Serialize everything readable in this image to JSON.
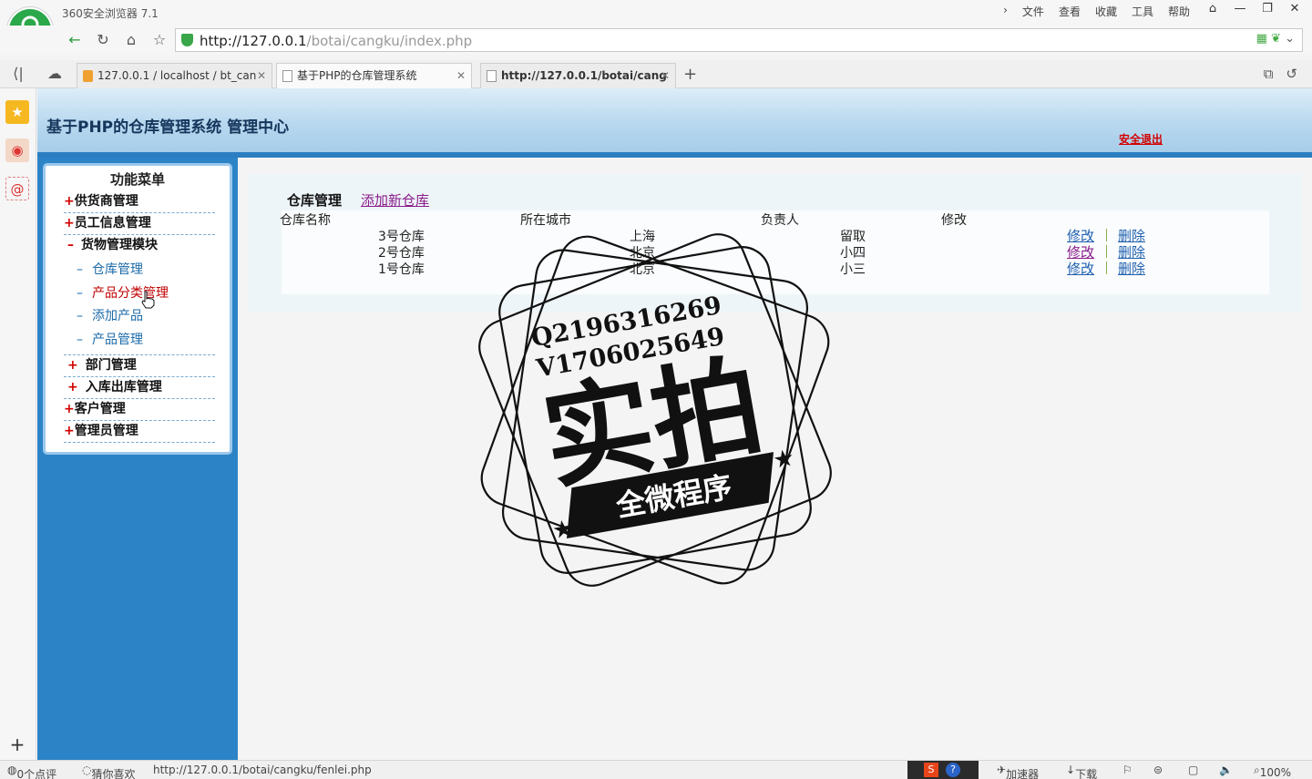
{
  "browser": {
    "name": "360安全浏览器 7.1",
    "menu": [
      "文件",
      "查看",
      "收藏",
      "工具",
      "帮助"
    ],
    "url_host": "http://127.0.0.1",
    "url_path": "/botai/cangku/index.php",
    "tabs": [
      {
        "label": "127.0.0.1 / localhost / bt_can"
      },
      {
        "label": "基于PHP的仓库管理系统"
      },
      {
        "label": "http://127.0.0.1/botai/cang"
      }
    ]
  },
  "header": {
    "title": "基于PHP的仓库管理系统 管理中心",
    "logout": "安全退出"
  },
  "sidebar": {
    "title": "功能菜单",
    "items": [
      {
        "mark": "+",
        "label": "供货商管理"
      },
      {
        "mark": "+",
        "label": "员工信息管理"
      },
      {
        "mark": "–",
        "label": "货物管理模块"
      },
      {
        "mark": "+",
        "label": "部门管理"
      },
      {
        "mark": "+",
        "label": "入库出库管理"
      },
      {
        "mark": "+",
        "label": "客户管理"
      },
      {
        "mark": "+",
        "label": "管理员管理"
      }
    ],
    "subitems": [
      {
        "mark": "–",
        "label": "仓库管理"
      },
      {
        "mark": "–",
        "label": "产品分类管理"
      },
      {
        "mark": "–",
        "label": "添加产品"
      },
      {
        "mark": "–",
        "label": "产品管理"
      }
    ]
  },
  "table": {
    "title": "仓库管理",
    "add_link": "添加新仓库",
    "headers": [
      "仓库名称",
      "所在城市",
      "负责人",
      "修改"
    ],
    "rows": [
      {
        "name": "3号仓库",
        "city": "上海",
        "manager": "留取",
        "edit": "修改",
        "delete": "删除"
      },
      {
        "name": "2号仓库",
        "city": "北京",
        "manager": "小四",
        "edit": "修改",
        "delete": "删除"
      },
      {
        "name": "1号仓库",
        "city": "北京",
        "manager": "小三",
        "edit": "修改",
        "delete": "删除"
      }
    ]
  },
  "watermark": {
    "line1": "Q2196316269",
    "line2": "V1706025649",
    "big": "实拍",
    "banner": "全微程序"
  },
  "status": {
    "reviews": "0个点评",
    "guess": "猜你喜欢",
    "link": "http://127.0.0.1/botai/cangku/fenlei.php",
    "accel": "加速器",
    "download": "下载",
    "zoom": "100%"
  }
}
